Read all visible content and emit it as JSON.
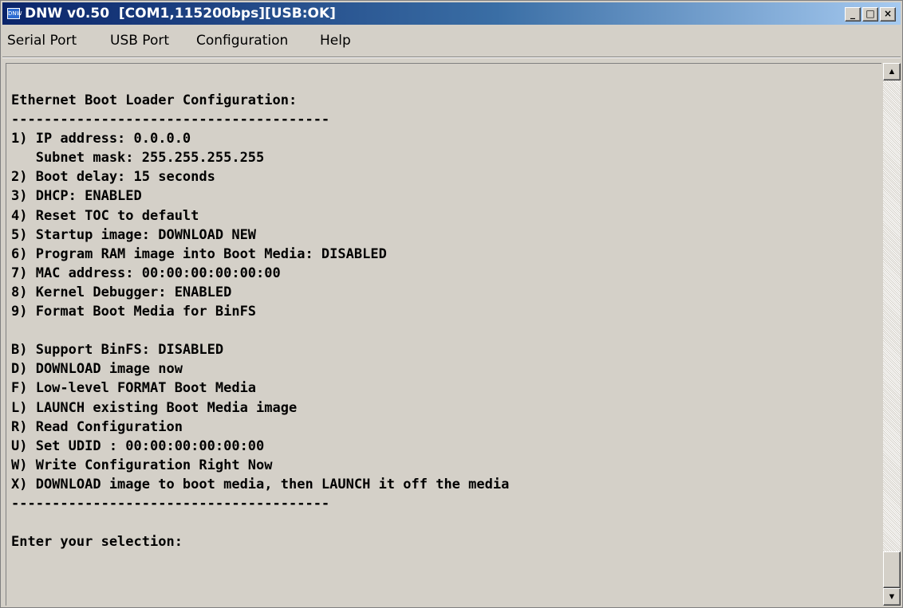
{
  "window": {
    "title": "DNW v0.50  [COM1,115200bps][USB:OK]",
    "icon": "dnw-app-icon",
    "controls": [
      "minimize-icon",
      "maximize-icon",
      "close-icon"
    ]
  },
  "menu": {
    "items": [
      {
        "label": "Serial Port"
      },
      {
        "label": "USB Port"
      },
      {
        "label": "Configuration"
      },
      {
        "label": "Help"
      }
    ]
  },
  "terminal": {
    "lines": [
      "Ethernet Boot Loader Configuration:",
      "---------------------------------------",
      "1) IP address: 0.0.0.0",
      "   Subnet mask: 255.255.255.255",
      "2) Boot delay: 15 seconds",
      "3) DHCP: ENABLED",
      "4) Reset TOC to default",
      "5) Startup image: DOWNLOAD NEW",
      "6) Program RAM image into Boot Media: DISABLED",
      "7) MAC address: 00:00:00:00:00:00",
      "8) Kernel Debugger: ENABLED",
      "9) Format Boot Media for BinFS",
      "",
      "B) Support BinFS: DISABLED",
      "D) DOWNLOAD image now",
      "F) Low-level FORMAT Boot Media",
      "L) LAUNCH existing Boot Media image",
      "R) Read Configuration",
      "U) Set UDID : 00:00:00:00:00:00",
      "W) Write Configuration Right Now",
      "X) DOWNLOAD image to boot media, then LAUNCH it off the media",
      "---------------------------------------",
      "",
      "Enter your selection:"
    ]
  },
  "colors": {
    "titlebar": "#0a246a",
    "face": "#d4d0c8",
    "text": "#000000"
  }
}
